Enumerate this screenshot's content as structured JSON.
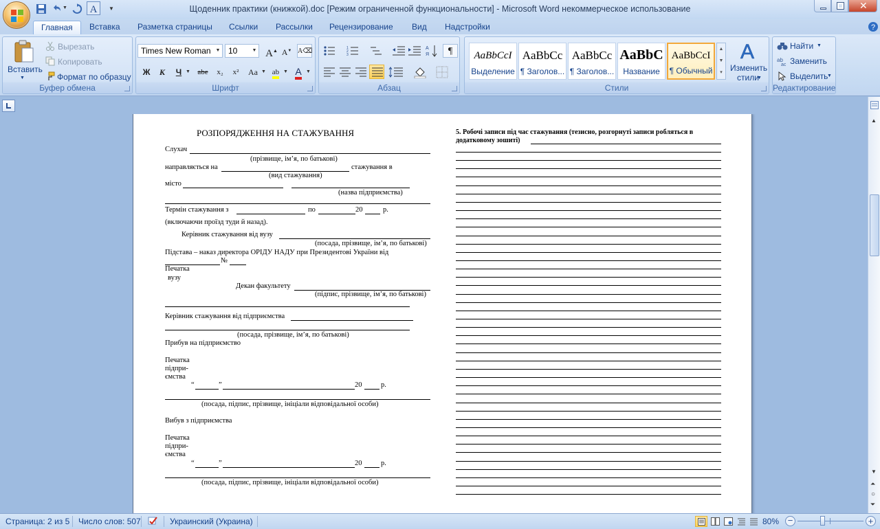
{
  "window": {
    "title": "Щоденник практики (книжкой).doc [Режим ограниченной функциональности] - Microsoft Word некоммерческое использование"
  },
  "tabs": [
    {
      "label": "Главная",
      "active": true
    },
    {
      "label": "Вставка"
    },
    {
      "label": "Разметка страницы"
    },
    {
      "label": "Ссылки"
    },
    {
      "label": "Рассылки"
    },
    {
      "label": "Рецензирование"
    },
    {
      "label": "Вид"
    },
    {
      "label": "Надстройки"
    }
  ],
  "ribbon": {
    "clipboard": {
      "label": "Буфер обмена",
      "paste": "Вставить",
      "cut": "Вырезать",
      "copy": "Копировать",
      "format_painter": "Формат по образцу"
    },
    "font": {
      "label": "Шрифт",
      "font_name": "Times New Roman",
      "font_size": "10",
      "bold": "Ж",
      "italic": "К",
      "underline": "Ч",
      "strike": "abe",
      "subscript": "x₂",
      "superscript": "x²",
      "change_case": "Aa"
    },
    "paragraph": {
      "label": "Абзац"
    },
    "styles": {
      "label": "Стили",
      "items": [
        {
          "sample": "AaBbCcI",
          "name": "Выделение",
          "italic": true
        },
        {
          "sample": "AaBbCc",
          "name": "¶ Заголов..."
        },
        {
          "sample": "AaBbCc",
          "name": "¶ Заголов..."
        },
        {
          "sample": "AaBbC",
          "name": "Название",
          "bold": true
        },
        {
          "sample": "AaBbCcI",
          "name": "¶ Обычный",
          "selected": true
        }
      ],
      "change_styles_1": "Изменить",
      "change_styles_2": "стили"
    },
    "editing": {
      "label": "Редактирование",
      "find": "Найти",
      "replace": "Заменить",
      "select": "Выделить"
    }
  },
  "document": {
    "left": {
      "heading": "РОЗПОРЯДЖЕННЯ НА СТАЖУВАННЯ",
      "l1": "Слухач",
      "l1_sub": "(прізвище, ім’я, по батькові)",
      "l2a": "направляється на",
      "l2b": "стажування в",
      "l2_sub": "(вид стажування)",
      "l3": "місто",
      "l3_sub": "(назва підприємства)",
      "l4a": "Термін стажування з",
      "l4b": "по",
      "l4c": "20",
      "l4d": "р.",
      "l5": "(включаючи проїзд туди й назад).",
      "l6": "Керівник стажування від вузу",
      "l6_sub": "(посада, прізвище, ім’я, по батькові)",
      "l7": "Підстава – наказ директора ОРІДУ НАДУ при Президентові України від",
      "l8": "№",
      "l9": "Печатка",
      "l10": "вузу",
      "l11": "Декан факультету",
      "l11_sub": "(підпис, прізвище, ім’я, по батькові)",
      "l12": "Керівник стажування від підприємства",
      "l12_sub": "(посада, прізвище, ім’я, по батькові)",
      "l13": "Прибув на підприємство",
      "stamp1": "Печатка",
      "stamp2": "підпри-",
      "stamp3": "ємства",
      "date_q1": "“",
      "date_q2": "”",
      "date_year": "20",
      "date_r": "р.",
      "sign_sub": "(посада, підпис, прізвище, ініціали відповідальної особи)",
      "l14": "Вибув з підприємства"
    },
    "right": {
      "heading1": "5. Робочі записи під час стажування (тезисно, розгорнуті записи робляться в",
      "heading2": "додатковому зошиті)"
    }
  },
  "status": {
    "page": "Страница: 2 из 5",
    "words": "Число слов: 507",
    "language": "Украинский (Украина)",
    "zoom": "80%"
  }
}
